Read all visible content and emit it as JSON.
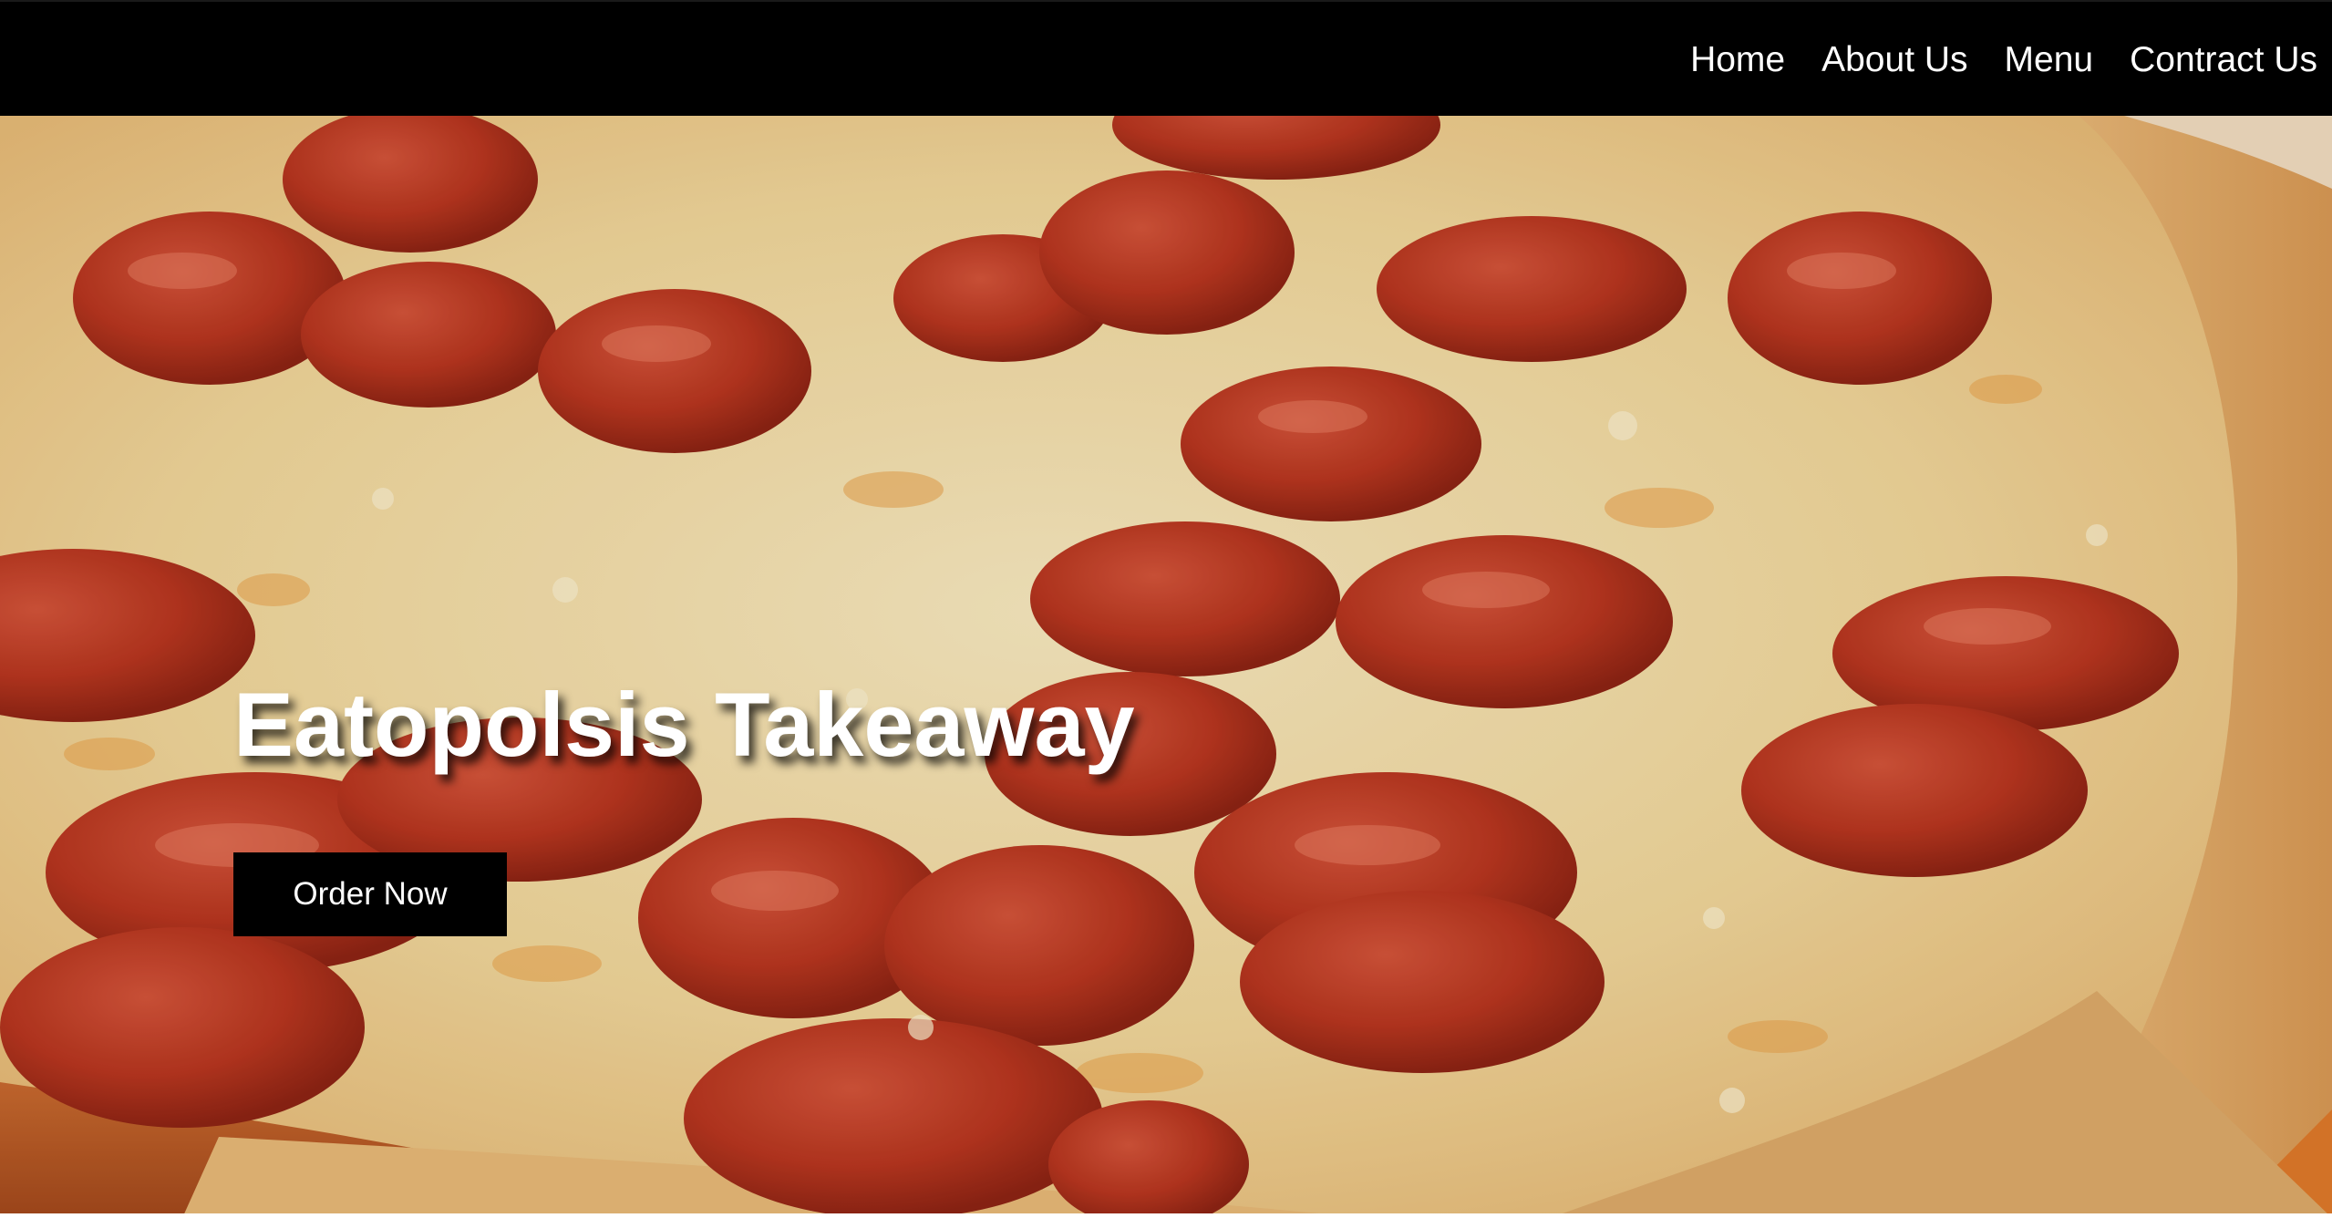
{
  "nav": {
    "items": [
      {
        "label": "Home"
      },
      {
        "label": "About Us"
      },
      {
        "label": "Menu"
      },
      {
        "label": "Contract Us"
      }
    ]
  },
  "hero": {
    "title": "Eatopolsis Takeaway",
    "cta_label": "Order Now",
    "background_image": "pepperoni-pizza-photo"
  },
  "colors": {
    "navbar_bg": "#000000",
    "nav_text": "#ffffff",
    "button_bg": "#000000",
    "button_text": "#ffffff",
    "cheese": "#f3dfae",
    "pepperoni": "#b8361f",
    "crust": "#e2ab66"
  }
}
